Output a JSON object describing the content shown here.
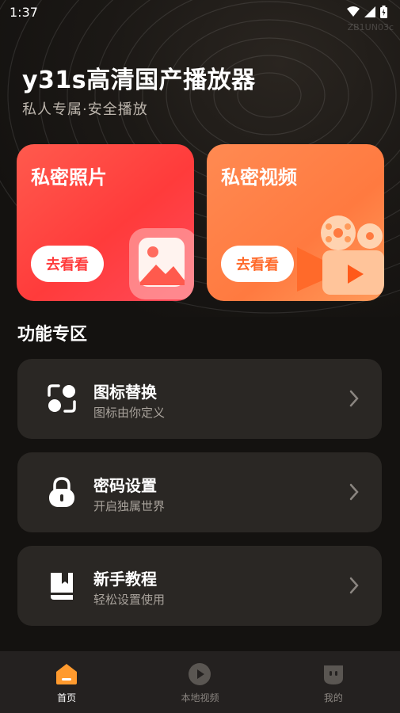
{
  "status_bar": {
    "time": "1:37"
  },
  "watermark": "ZB1UN03c",
  "header": {
    "title": "y31s高清国产播放器",
    "subtitle": "私人专属·安全播放"
  },
  "cards": [
    {
      "title": "私密照片",
      "button": "去看看"
    },
    {
      "title": "私密视频",
      "button": "去看看"
    }
  ],
  "section": {
    "title": "功能专区"
  },
  "features": [
    {
      "title": "图标替换",
      "subtitle": "图标由你定义",
      "icon": "swap-icon"
    },
    {
      "title": "密码设置",
      "subtitle": "开启独属世界",
      "icon": "lock-icon"
    },
    {
      "title": "新手教程",
      "subtitle": "轻松设置使用",
      "icon": "book-icon"
    }
  ],
  "tabs": [
    {
      "label": "首页",
      "icon": "home-icon",
      "active": true
    },
    {
      "label": "本地视频",
      "icon": "play-icon",
      "active": false
    },
    {
      "label": "我的",
      "icon": "profile-icon",
      "active": false
    }
  ],
  "colors": {
    "accent": "#ff9a2e",
    "photo_card": "#ff3b3b",
    "video_card": "#ff7a40",
    "item_bg": "#2a2724"
  }
}
